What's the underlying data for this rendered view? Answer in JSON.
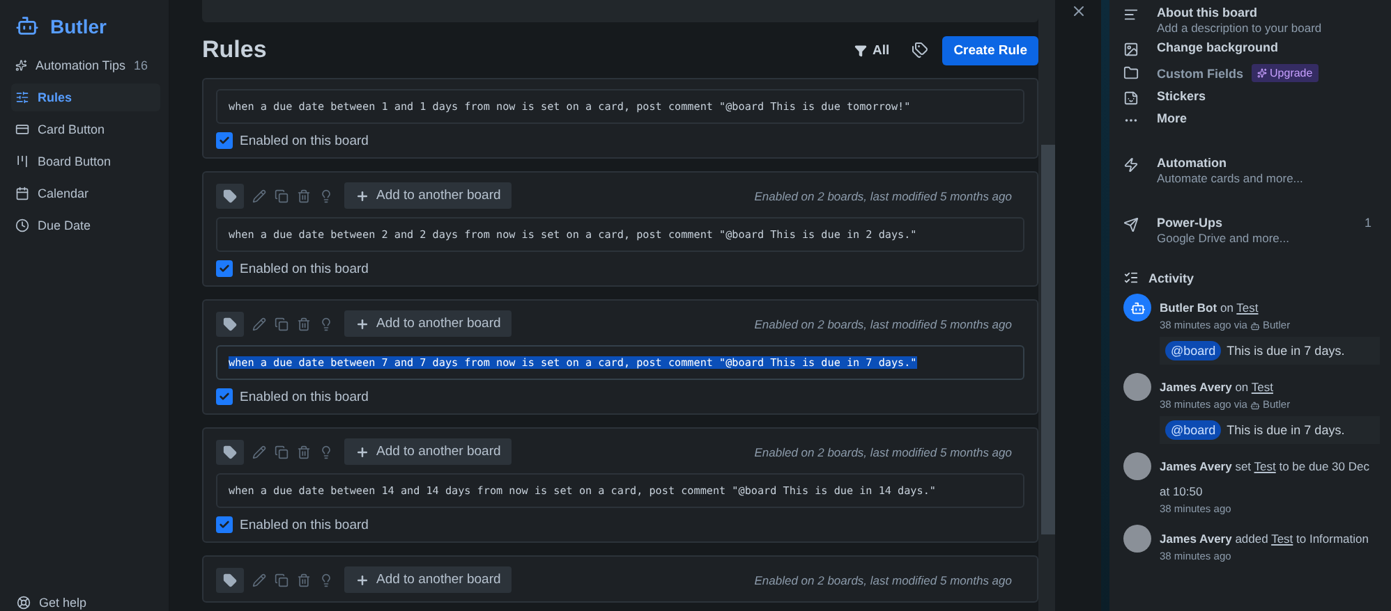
{
  "sidebar": {
    "title": "Butler",
    "items": [
      {
        "kind": "tips",
        "label": "Automation Tips",
        "count": "16",
        "selected": false
      },
      {
        "kind": "rules",
        "label": "Rules",
        "selected": true
      },
      {
        "kind": "card",
        "label": "Card Button",
        "selected": false
      },
      {
        "kind": "board",
        "label": "Board Button",
        "selected": false
      },
      {
        "kind": "calendar",
        "label": "Calendar",
        "selected": false
      },
      {
        "kind": "due",
        "label": "Due Date",
        "selected": false
      }
    ],
    "footer_link": "Get help"
  },
  "rules_panel": {
    "title": "Rules",
    "filter_label": "All",
    "create_button": "Create Rule",
    "rules": [
      {
        "command": "when a due date between 1 and 1 days from now is set on a card, post comment \"@board This is due tomorrow!\"",
        "enabled": true,
        "enabled_label": "Enabled on this board",
        "selected": false
      },
      {
        "add_button": "Add to another board",
        "meta": "Enabled on 2 boards, last modified 5 months ago",
        "command": "when a due date between 2 and 2 days from now is set on a card, post comment \"@board This is due in 2 days.\"",
        "enabled": true,
        "enabled_label": "Enabled on this board",
        "selected": false
      },
      {
        "add_button": "Add to another board",
        "meta": "Enabled on 2 boards, last modified 5 months ago",
        "command": "when a due date between 7 and 7 days from now is set on a card, post comment \"@board This is due in 7 days.\"",
        "enabled": true,
        "enabled_label": "Enabled on this board",
        "selected": true
      },
      {
        "add_button": "Add to another board",
        "meta": "Enabled on 2 boards, last modified 5 months ago",
        "command": "when a due date between 14 and 14 days from now is set on a card, post comment \"@board This is due in 14 days.\"",
        "enabled": true,
        "enabled_label": "Enabled on this board",
        "selected": false
      },
      {
        "add_button": "Add to another board",
        "meta": "Enabled on 2 boards, last modified 5 months ago"
      }
    ]
  },
  "board_menu": {
    "items": [
      {
        "kind": "about",
        "title": "About this board",
        "subtitle": "Add a description to your board"
      },
      {
        "kind": "background",
        "title": "Change background"
      },
      {
        "kind": "fields",
        "title": "Custom Fields",
        "badge": "Upgrade"
      },
      {
        "kind": "stickers",
        "title": "Stickers"
      },
      {
        "kind": "more",
        "title": "More"
      },
      {
        "kind": "automation",
        "title": "Automation",
        "subtitle": "Automate cards and more..."
      },
      {
        "kind": "powerups",
        "title": "Power-Ups",
        "subtitle": "Google Drive and more...",
        "count": "1"
      }
    ]
  },
  "activity": {
    "title": "Activity",
    "entries": [
      {
        "kind": "bot",
        "author": "Butler Bot",
        "verb": "on",
        "card": "Test",
        "time": "38 minutes ago via",
        "via": "Butler",
        "comment_mention": "@board",
        "comment": "This is due in 7 days."
      },
      {
        "kind": "person",
        "author": "James Avery",
        "verb": "on",
        "card": "Test",
        "time": "38 minutes ago via",
        "via": "Butler",
        "comment_mention": "@board",
        "comment": "This is due in 7 days."
      },
      {
        "kind": "person",
        "author": "James Avery",
        "verb": "set",
        "card": "Test",
        "rest": "to be due 30 Dec at 10:50",
        "time": "38 minutes ago"
      },
      {
        "kind": "person",
        "author": "James Avery",
        "verb": "added",
        "card": "Test",
        "rest": "to Information",
        "time": "38 minutes ago"
      }
    ]
  }
}
